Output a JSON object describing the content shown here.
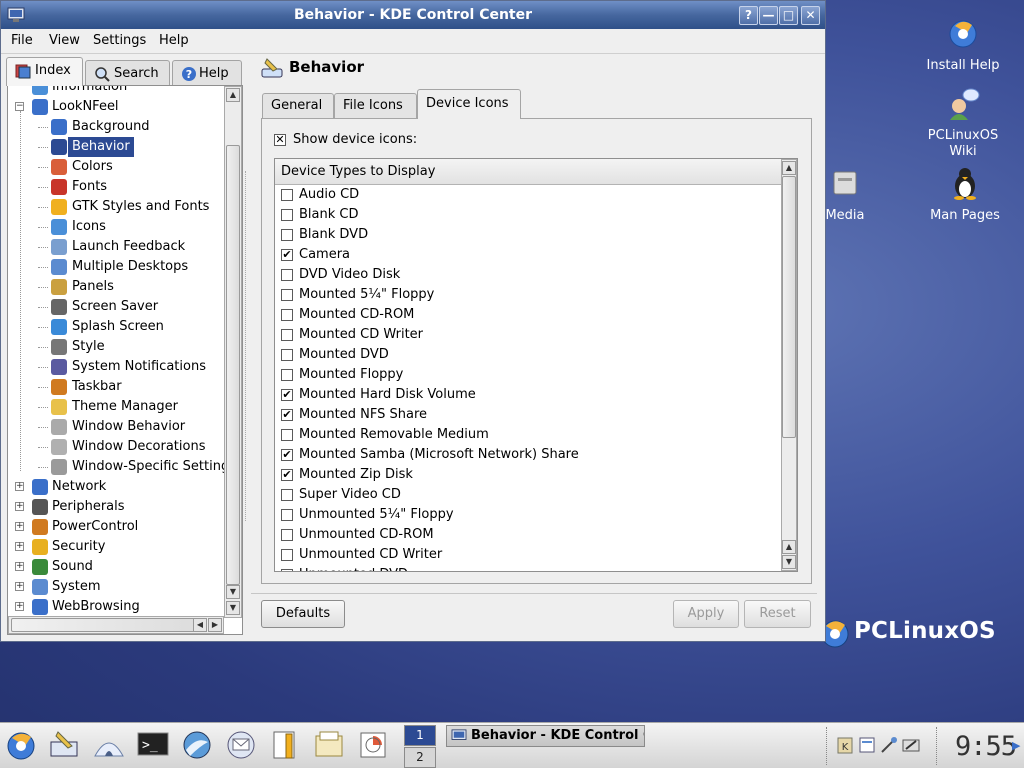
{
  "window": {
    "title": "Behavior - KDE Control Center",
    "buttons": {
      "help": "?",
      "minimize": "—",
      "maximize": "□",
      "close": "✕"
    }
  },
  "menubar": {
    "items": [
      "File",
      "View",
      "Settings",
      "Help"
    ]
  },
  "navigator": {
    "tabs": {
      "index": "Index",
      "search": "Search",
      "help": "Help"
    },
    "tree": {
      "partial_top": "Information",
      "lookandfeel": "LookNFeel",
      "children": [
        "Background",
        "Behavior",
        "Colors",
        "Fonts",
        "GTK Styles and Fonts",
        "Icons",
        "Launch Feedback",
        "Multiple Desktops",
        "Panels",
        "Screen Saver",
        "Splash Screen",
        "Style",
        "System Notifications",
        "Taskbar",
        "Theme Manager",
        "Window Behavior",
        "Window Decorations",
        "Window-Specific Settings"
      ],
      "selected": "Behavior",
      "groups": [
        "Network",
        "Peripherals",
        "PowerControl",
        "Security",
        "Sound",
        "System",
        "WebBrowsing"
      ]
    }
  },
  "module": {
    "title": "Behavior",
    "tabs": [
      "General",
      "File Icons",
      "Device Icons"
    ],
    "active_tab": "Device Icons",
    "show_device_icons": {
      "label": "Show device icons:",
      "checked": true
    },
    "list_header": "Device Types to Display",
    "items": [
      {
        "label": "Audio CD",
        "checked": false
      },
      {
        "label": "Blank CD",
        "checked": false
      },
      {
        "label": "Blank DVD",
        "checked": false
      },
      {
        "label": "Camera",
        "checked": true
      },
      {
        "label": "DVD Video Disk",
        "checked": false
      },
      {
        "label": "Mounted 5¼\" Floppy",
        "checked": false
      },
      {
        "label": "Mounted CD-ROM",
        "checked": false
      },
      {
        "label": "Mounted CD Writer",
        "checked": false
      },
      {
        "label": "Mounted DVD",
        "checked": false
      },
      {
        "label": "Mounted Floppy",
        "checked": false
      },
      {
        "label": "Mounted Hard Disk Volume",
        "checked": true
      },
      {
        "label": "Mounted NFS Share",
        "checked": true
      },
      {
        "label": "Mounted Removable Medium",
        "checked": false
      },
      {
        "label": "Mounted Samba (Microsoft Network) Share",
        "checked": true
      },
      {
        "label": "Mounted Zip Disk",
        "checked": true
      },
      {
        "label": "Super Video CD",
        "checked": false
      },
      {
        "label": "Unmounted 5¼\" Floppy",
        "checked": false
      },
      {
        "label": "Unmounted CD-ROM",
        "checked": false
      },
      {
        "label": "Unmounted CD Writer",
        "checked": false
      },
      {
        "label": "Unmounted DVD",
        "checked": false
      }
    ],
    "buttons": {
      "defaults": "Defaults",
      "apply": "Apply",
      "reset": "Reset"
    }
  },
  "desktop": {
    "icons": {
      "install_help": "Install Help",
      "pclinuxos_wiki_line1": "PCLinuxOS",
      "pclinuxos_wiki_line2": "Wiki",
      "media": "Media",
      "man_pages": "Man Pages"
    },
    "brand": "PCLinuxOS"
  },
  "taskbar": {
    "pager": [
      "1",
      "2"
    ],
    "task_label": "Behavior - KDE Control Center",
    "clock": "9:55"
  },
  "colors": {
    "titlebar": "#46679f",
    "selection": "#2c4a93",
    "desktop": "#3f529a"
  }
}
